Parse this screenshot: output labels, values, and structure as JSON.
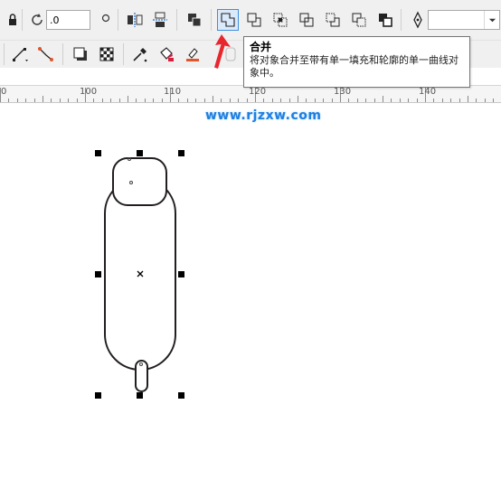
{
  "toolbar_top": {
    "rotate_value": ".0",
    "active_tool": "weld",
    "outline_width_value": ""
  },
  "tooltip": {
    "title": "合并",
    "description": "将对象合并至带有单一填充和轮廓的单一曲线对象中。"
  },
  "ruler": {
    "unit_ticks": [
      "100",
      "110",
      "120",
      "130",
      "140"
    ],
    "partial_left": "0"
  },
  "canvas": {
    "watermark": "www.rjzxw.com"
  },
  "colors": {
    "toolbar_bg": "#f0f0f0",
    "active_border": "#3c8fdf",
    "pointer_arrow": "#e8262e",
    "watermark": "#1f7fe0",
    "shape_stroke": "#231f20"
  }
}
